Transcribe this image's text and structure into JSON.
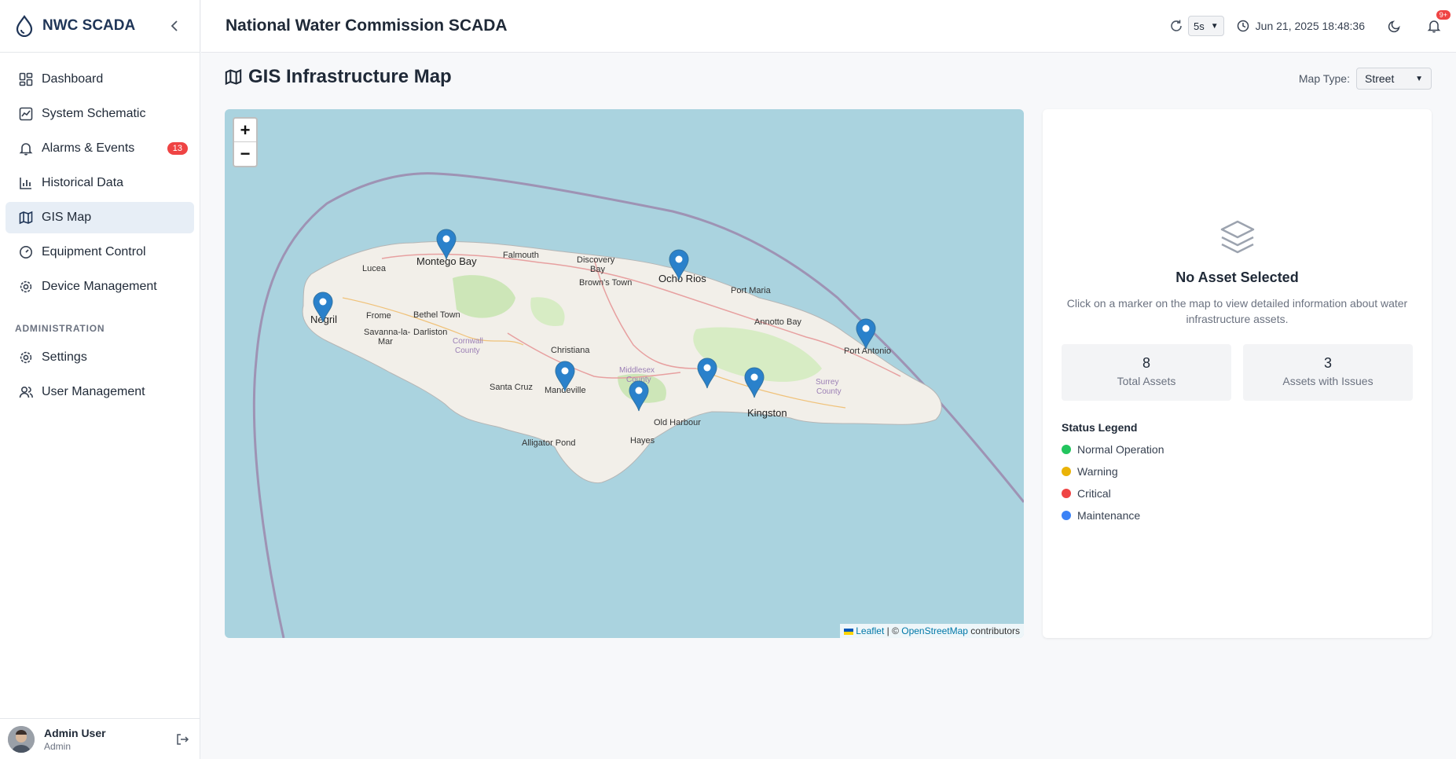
{
  "app": {
    "name": "NWC SCADA"
  },
  "sidebar": {
    "items": [
      {
        "label": "Dashboard",
        "icon": "dashboard-icon"
      },
      {
        "label": "System Schematic",
        "icon": "schematic-icon"
      },
      {
        "label": "Alarms & Events",
        "icon": "bell-icon",
        "badge": "13"
      },
      {
        "label": "Historical Data",
        "icon": "bar-chart-icon"
      },
      {
        "label": "GIS Map",
        "icon": "map-icon",
        "active": true
      },
      {
        "label": "Equipment Control",
        "icon": "gauge-icon"
      },
      {
        "label": "Device Management",
        "icon": "gear-icon"
      }
    ],
    "admin_title": "ADMINISTRATION",
    "admin_items": [
      {
        "label": "Settings",
        "icon": "gear-icon"
      },
      {
        "label": "User Management",
        "icon": "users-icon"
      }
    ],
    "user": {
      "name": "Admin User",
      "role": "Admin"
    }
  },
  "header": {
    "title": "National Water Commission SCADA",
    "refresh_interval": "5s",
    "datetime": "Jun 21, 2025 18:48:36",
    "notification_badge": "9+"
  },
  "page": {
    "title": "GIS Infrastructure Map",
    "map_type_label": "Map Type:",
    "map_type_value": "Street"
  },
  "map": {
    "zoom_in": "+",
    "zoom_out": "−",
    "attribution_leaflet": "Leaflet",
    "attribution_sep": " | © ",
    "attribution_osm": "OpenStreetMap",
    "attribution_tail": " contributors",
    "labels": {
      "montego_bay": "Montego Bay",
      "falmouth": "Falmouth",
      "discovery_bay": "Discovery",
      "discovery_bay2": "Bay",
      "ocho_rios": "Ocho Rios",
      "browns_town": "Brown's Town",
      "port_maria": "Port Maria",
      "lucea": "Lucea",
      "negril": "Negril",
      "frome": "Frome",
      "bethel_town": "Bethel Town",
      "savanna_la_mar": "Savanna-la-",
      "savanna_la_mar2": "Mar",
      "darliston": "Darliston",
      "cornwall": "Cornwall",
      "cornwall2": "County",
      "christiana": "Christiana",
      "middlesex": "Middlesex",
      "middlesex2": "County",
      "annotto_bay": "Annotto Bay",
      "port_antonio": "Port Antonio",
      "santa_cruz": "Santa Cruz",
      "mandeville": "Mandeville",
      "old_harbour": "Old Harbour",
      "kingston": "Kingston",
      "surrey": "Surrey",
      "surrey2": "County",
      "alligator_pond": "Alligator Pond",
      "hayes": "Hayes"
    },
    "marker_color": "#2a81cb"
  },
  "panel": {
    "empty_title": "No Asset Selected",
    "empty_desc": "Click on a marker on the map to view detailed information about water infrastructure assets.",
    "total_assets": "8",
    "total_assets_label": "Total Assets",
    "issues": "3",
    "issues_label": "Assets with Issues",
    "legend_title": "Status Legend",
    "legend": [
      {
        "label": "Normal Operation",
        "color": "#22c55e"
      },
      {
        "label": "Warning",
        "color": "#eab308"
      },
      {
        "label": "Critical",
        "color": "#ef4444"
      },
      {
        "label": "Maintenance",
        "color": "#3b82f6"
      }
    ]
  }
}
